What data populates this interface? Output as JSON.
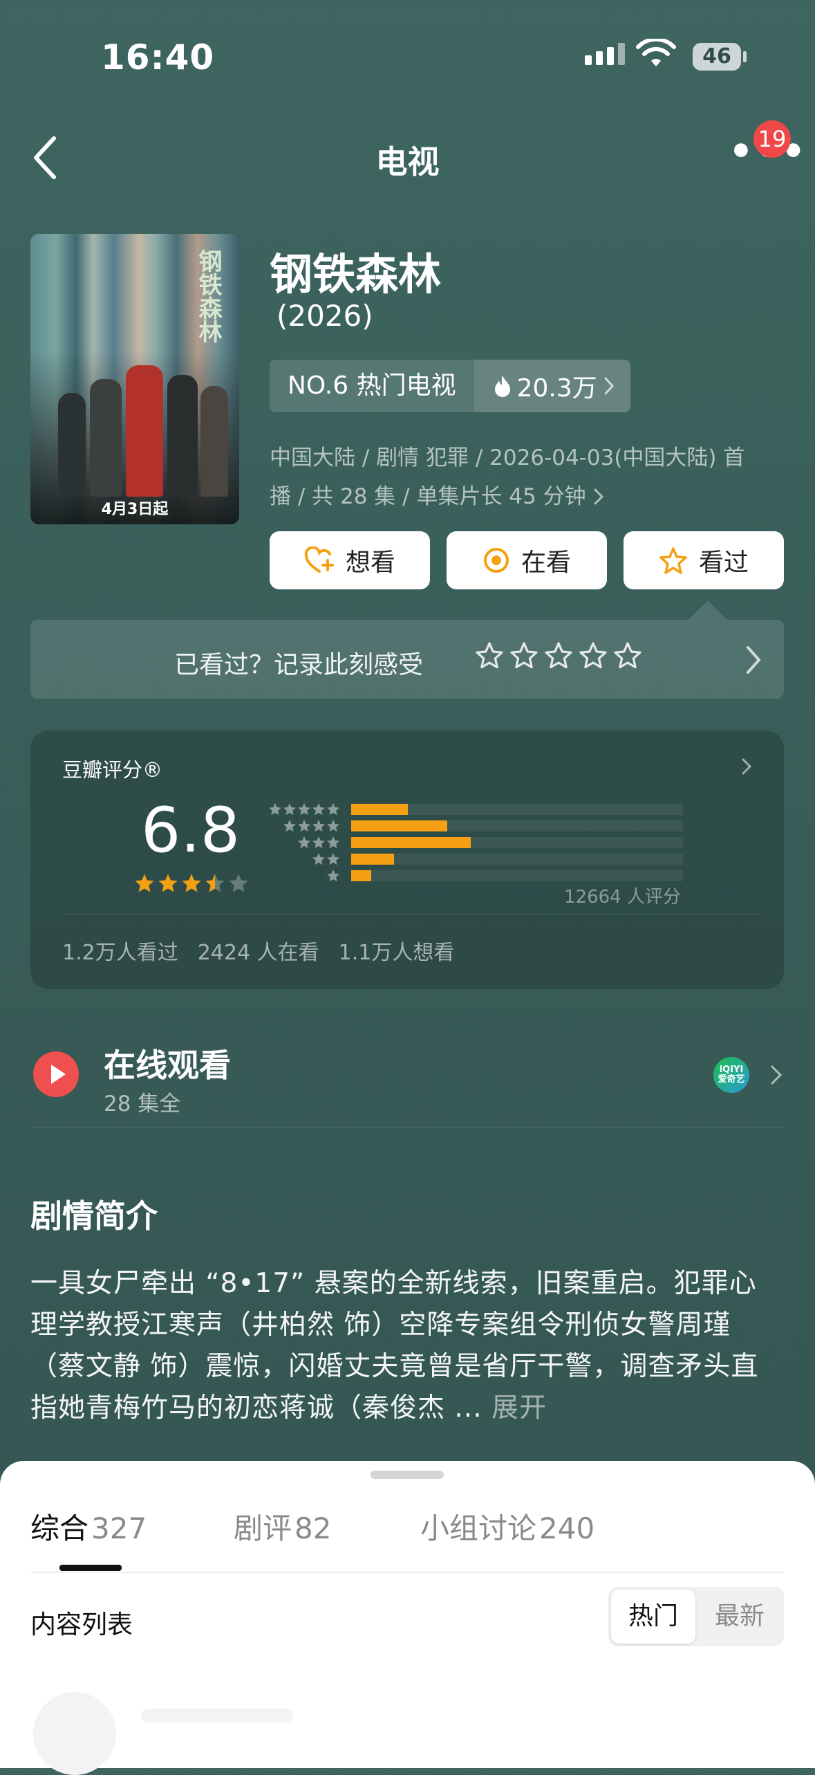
{
  "status_bar": {
    "time": "16:40",
    "battery": "46"
  },
  "nav": {
    "title": "电视",
    "badge": "19"
  },
  "show": {
    "poster_title": "钢铁森林",
    "poster_date": "4月3日起",
    "title": "钢铁森林",
    "year": "(2026)",
    "rank_label": "NO.6 热门电视",
    "heat": "20.3万",
    "meta_line1": "中国大陆 / 剧情 犯罪 / 2026-04-03(中国大陆) 首",
    "meta_line2": "播 / 共 28 集 / 单集片长 45 分钟"
  },
  "actions": [
    {
      "label": "想看",
      "icon": "heart-plus-icon"
    },
    {
      "label": "在看",
      "icon": "target-icon"
    },
    {
      "label": "看过",
      "icon": "star-icon"
    }
  ],
  "record": {
    "text": "已看过？记录此刻感受"
  },
  "rating": {
    "label": "豆瓣评分®",
    "score": "6.8",
    "stars": 3.5,
    "distribution": [
      {
        "stars": 5,
        "fraction": 0.17
      },
      {
        "stars": 4,
        "fraction": 0.29
      },
      {
        "stars": 3,
        "fraction": 0.36
      },
      {
        "stars": 2,
        "fraction": 0.13
      },
      {
        "stars": 1,
        "fraction": 0.06
      }
    ],
    "votes": "12664 人评分",
    "stats": [
      "1.2万人看过",
      "2424 人在看",
      "1.1万人想看"
    ]
  },
  "watch": {
    "title": "在线观看",
    "subtitle": "28 集全",
    "platform_logo_text": "iQIYI 爱奇艺"
  },
  "synopsis": {
    "heading": "剧情简介",
    "text": "一具女尸牵出 “8•17” 悬案的全新线索，旧案重启。犯罪心理学教授江寒声（井柏然 饰）空降专案组令刑侦女警周瑾（蔡文静 饰）震惊，闪婚丈夫竟曾是省厅干警，调查矛头直指她青梅竹马的初恋蒋诚（秦俊杰 ... ",
    "expand": "展开"
  },
  "sheet": {
    "tabs": [
      {
        "label": "综合",
        "count": "327"
      },
      {
        "label": "剧评",
        "count": "82"
      },
      {
        "label": "小组讨论",
        "count": "240"
      }
    ],
    "list_heading": "内容列表",
    "sort_options": [
      "热门",
      "最新"
    ]
  },
  "colors": {
    "accent_orange": "#f5a013",
    "play_red": "#ef4f4f",
    "badge_red": "#f04848",
    "background": "#3a5f5a"
  }
}
